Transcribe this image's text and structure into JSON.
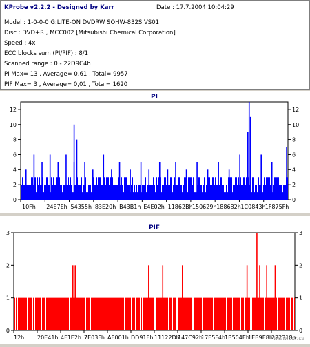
{
  "header": {
    "title": "KProbe v2.2.2 - Designed by Karr",
    "date": "Date : 17.7.2004 10:04:29",
    "lines": [
      "Model : 1-0-0-0 G:LITE-ON DVDRW SOHW-832S  VS01",
      "Disc : DVD+R , MCC002 [Mitsubishi Chemical Corporation]",
      "Speed : 4x",
      "ECC blocks sum (PI/PIF) : 8/1",
      "Scanned range : 0 - 22D9C4h",
      "PI Max= 13 , Average= 0,61 , Total= 9957",
      "PIF Max= 3 , Average= 0,01 , Total= 1620"
    ]
  },
  "watermark": "www.cdr.cz",
  "chart_data": [
    {
      "type": "bar",
      "title": "PI",
      "color": "#0000ff",
      "ylim": [
        0,
        13
      ],
      "yticks": [
        0,
        2,
        4,
        6,
        8,
        10,
        12
      ],
      "xticklabels": [
        "10Fh",
        "24E7Eh",
        "54355h",
        "83E20h",
        "B43B1h",
        "E4E02h",
        "11862Bh",
        "150629h",
        "188682h",
        "1C0843h",
        "1F875Fh"
      ],
      "grid": false,
      "baseline_level": 2,
      "spikes": [
        {
          "pos": 0.02,
          "value": 4
        },
        {
          "pos": 0.05,
          "value": 6
        },
        {
          "pos": 0.08,
          "value": 5
        },
        {
          "pos": 0.11,
          "value": 6
        },
        {
          "pos": 0.14,
          "value": 5
        },
        {
          "pos": 0.17,
          "value": 6
        },
        {
          "pos": 0.2,
          "value": 5
        },
        {
          "pos": 0.2,
          "value": 10
        },
        {
          "pos": 0.21,
          "value": 8
        },
        {
          "pos": 0.24,
          "value": 5
        },
        {
          "pos": 0.27,
          "value": 4
        },
        {
          "pos": 0.31,
          "value": 6
        },
        {
          "pos": 0.34,
          "value": 4
        },
        {
          "pos": 0.37,
          "value": 5
        },
        {
          "pos": 0.41,
          "value": 4
        },
        {
          "pos": 0.45,
          "value": 5
        },
        {
          "pos": 0.48,
          "value": 4
        },
        {
          "pos": 0.52,
          "value": 5
        },
        {
          "pos": 0.55,
          "value": 4
        },
        {
          "pos": 0.58,
          "value": 5
        },
        {
          "pos": 0.62,
          "value": 4
        },
        {
          "pos": 0.66,
          "value": 5
        },
        {
          "pos": 0.7,
          "value": 4
        },
        {
          "pos": 0.74,
          "value": 5
        },
        {
          "pos": 0.78,
          "value": 4
        },
        {
          "pos": 0.82,
          "value": 6
        },
        {
          "pos": 0.85,
          "value": 9
        },
        {
          "pos": 0.855,
          "value": 13
        },
        {
          "pos": 0.86,
          "value": 11
        },
        {
          "pos": 0.9,
          "value": 6
        },
        {
          "pos": 0.94,
          "value": 5
        },
        {
          "pos": 0.995,
          "value": 7
        }
      ]
    },
    {
      "type": "bar",
      "title": "PIF",
      "color": "#ff0000",
      "ylim": [
        0,
        3
      ],
      "yticks": [
        0,
        1,
        2,
        3
      ],
      "xticklabels": [
        "12h",
        "20E41h",
        "4F1E2h",
        "7E03Fh",
        "AE001h",
        "DD91Eh",
        "11122Dh",
        "147C92h",
        "17E5F4h",
        "1B504Eh",
        "1EB9E8h",
        "222318h"
      ],
      "grid": false,
      "baseline_level": 1,
      "spikes": [
        {
          "pos": 0.21,
          "value": 2
        },
        {
          "pos": 0.215,
          "value": 2
        },
        {
          "pos": 0.22,
          "value": 2
        },
        {
          "pos": 0.48,
          "value": 2
        },
        {
          "pos": 0.53,
          "value": 2
        },
        {
          "pos": 0.6,
          "value": 2
        },
        {
          "pos": 0.83,
          "value": 2
        },
        {
          "pos": 0.865,
          "value": 3
        },
        {
          "pos": 0.875,
          "value": 2
        },
        {
          "pos": 0.9,
          "value": 2
        },
        {
          "pos": 0.93,
          "value": 2
        }
      ]
    }
  ]
}
